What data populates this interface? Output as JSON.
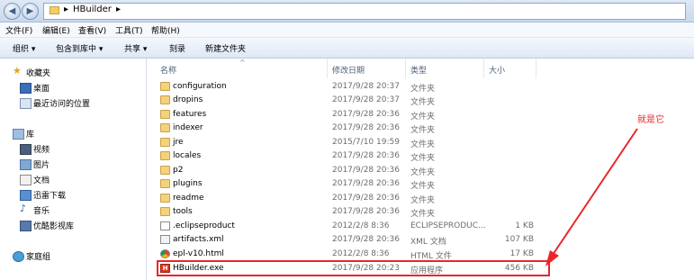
{
  "address_bar": {
    "breadcrumb": [
      "HBuilder"
    ]
  },
  "menu": [
    "文件(F)",
    "编辑(E)",
    "查看(V)",
    "工具(T)",
    "帮助(H)"
  ],
  "toolbar": [
    "组织 ▾",
    "包含到库中 ▾",
    "共享 ▾",
    "刻录",
    "新建文件夹"
  ],
  "sidebar": {
    "favorites": {
      "label": "收藏夹",
      "items": [
        "桌面",
        "最近访问的位置"
      ]
    },
    "libraries": {
      "label": "库",
      "items": [
        "视频",
        "图片",
        "文档",
        "迅雷下载",
        "音乐",
        "优酷影视库"
      ]
    },
    "homegroup": "家庭组"
  },
  "columns": {
    "name": "名称",
    "date": "修改日期",
    "type": "类型",
    "size": "大小"
  },
  "files": [
    {
      "name": "configuration",
      "date": "2017/9/28 20:37",
      "type": "文件夹",
      "size": "",
      "icon": "folder"
    },
    {
      "name": "dropins",
      "date": "2017/9/28 20:37",
      "type": "文件夹",
      "size": "",
      "icon": "folder"
    },
    {
      "name": "features",
      "date": "2017/9/28 20:36",
      "type": "文件夹",
      "size": "",
      "icon": "folder"
    },
    {
      "name": "indexer",
      "date": "2017/9/28 20:36",
      "type": "文件夹",
      "size": "",
      "icon": "folder"
    },
    {
      "name": "jre",
      "date": "2015/7/10 19:59",
      "type": "文件夹",
      "size": "",
      "icon": "folder"
    },
    {
      "name": "locales",
      "date": "2017/9/28 20:36",
      "type": "文件夹",
      "size": "",
      "icon": "folder"
    },
    {
      "name": "p2",
      "date": "2017/9/28 20:36",
      "type": "文件夹",
      "size": "",
      "icon": "folder"
    },
    {
      "name": "plugins",
      "date": "2017/9/28 20:36",
      "type": "文件夹",
      "size": "",
      "icon": "folder"
    },
    {
      "name": "readme",
      "date": "2017/9/28 20:36",
      "type": "文件夹",
      "size": "",
      "icon": "folder"
    },
    {
      "name": "tools",
      "date": "2017/9/28 20:36",
      "type": "文件夹",
      "size": "",
      "icon": "folder"
    },
    {
      "name": ".eclipseproduct",
      "date": "2012/2/8 8:36",
      "type": "ECLIPSEPRODUC...",
      "size": "1 KB",
      "icon": "file"
    },
    {
      "name": "artifacts.xml",
      "date": "2017/9/28 20:36",
      "type": "XML 文档",
      "size": "107 KB",
      "icon": "xml"
    },
    {
      "name": "epl-v10.html",
      "date": "2012/2/8 8:36",
      "type": "HTML 文件",
      "size": "17 KB",
      "icon": "chrome"
    },
    {
      "name": "HBuilder.exe",
      "date": "2017/9/28 20:23",
      "type": "应用程序",
      "size": "456 KB",
      "icon": "hbuilder"
    }
  ],
  "annotation": "就是它",
  "colors": {
    "annotation": "#e8262a",
    "folder": "#f3d27a"
  }
}
